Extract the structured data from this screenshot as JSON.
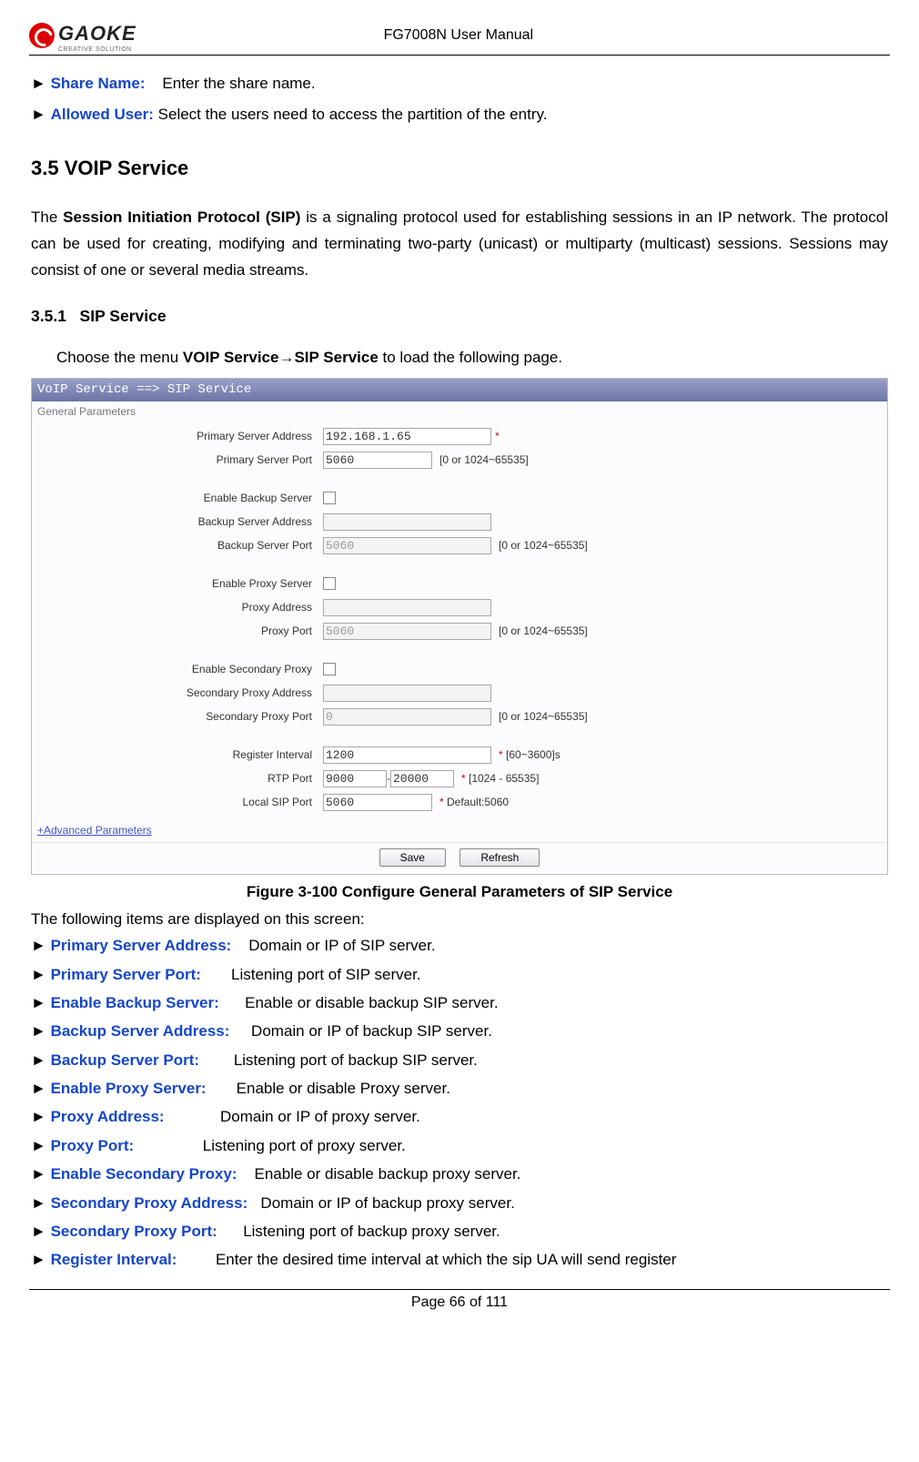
{
  "header": {
    "logo_text": "GAOKE",
    "logo_sub": "CREATIVE SOLUTION",
    "doc_title": "FG7008N User Manual"
  },
  "top_fields": [
    {
      "label": "Share Name:",
      "desc": "Enter the share name."
    },
    {
      "label": "Allowed User:",
      "desc": "Select the users need to access the partition of the entry."
    }
  ],
  "section": {
    "number": "3.5",
    "title": "VOIP Service"
  },
  "sip_intro_parts": {
    "pre": "The ",
    "bold": "Session Initiation Protocol (SIP)",
    "post": " is a signaling protocol used for establishing sessions in an IP network. The protocol can be used for creating, modifying and terminating two-party (unicast) or multiparty (multicast) sessions. Sessions may consist of one or several media streams."
  },
  "subsection": {
    "number": "3.5.1",
    "title": "SIP Service"
  },
  "menu_instruction": {
    "pre": "Choose the menu ",
    "b1": "VOIP Service",
    "arrow": "→",
    "b2": "SIP Service",
    "post": " to load the following page."
  },
  "ui": {
    "breadcrumb": "VoIP Service ==> SIP Service",
    "fieldset": "General Parameters",
    "rows": {
      "primary_addr": {
        "label": "Primary Server Address",
        "value": "192.168.1.65",
        "hint": "*",
        "star": true
      },
      "primary_port": {
        "label": "Primary Server Port",
        "value": "5060",
        "hint": "[0 or 1024~65535]"
      },
      "enable_backup": {
        "label": "Enable Backup Server"
      },
      "backup_addr": {
        "label": "Backup Server Address",
        "value": ""
      },
      "backup_port": {
        "label": "Backup Server Port",
        "value": "5060",
        "hint": "[0 or 1024~65535]"
      },
      "enable_proxy": {
        "label": "Enable Proxy Server"
      },
      "proxy_addr": {
        "label": "Proxy Address",
        "value": ""
      },
      "proxy_port": {
        "label": "Proxy Port",
        "value": "5060",
        "hint": "[0 or 1024~65535]"
      },
      "enable_secproxy": {
        "label": "Enable Secondary Proxy"
      },
      "secproxy_addr": {
        "label": "Secondary Proxy Address",
        "value": ""
      },
      "secproxy_port": {
        "label": "Secondary Proxy Port",
        "value": "0",
        "hint": "[0 or 1024~65535]"
      },
      "reg_interval": {
        "label": "Register Interval",
        "value": "1200",
        "hint": "* [60~3600]s",
        "star": true
      },
      "rtp_port": {
        "label": "RTP Port",
        "from": "9000",
        "to": "20000",
        "sep": " - ",
        "hint": "* [1024 - 65535]",
        "star": true
      },
      "local_sip": {
        "label": "Local SIP Port",
        "value": "5060",
        "hint": "* Default:5060",
        "star": true
      }
    },
    "adv_link": "+Advanced Parameters",
    "save_btn": "Save",
    "refresh_btn": "Refresh"
  },
  "figure_caption": "Figure 3-100 Configure General Parameters of SIP Service",
  "following_items": "The following items are displayed on this screen:",
  "defs": [
    {
      "label": "Primary Server Address:",
      "desc": "Domain or IP of SIP server."
    },
    {
      "label": "Primary Server Port:",
      "desc": "Listening port of SIP server."
    },
    {
      "label": "Enable Backup Server:",
      "desc": "Enable or disable backup SIP server."
    },
    {
      "label": "Backup Server Address:",
      "desc": "Domain or IP of backup SIP server."
    },
    {
      "label": "Backup Server Port:",
      "desc": "Listening port of backup SIP server."
    },
    {
      "label": "Enable Proxy Server:",
      "desc": "Enable or disable Proxy server."
    },
    {
      "label": "Proxy Address:",
      "desc": "Domain or IP of proxy server."
    },
    {
      "label": "Proxy Port:",
      "desc": "Listening port of proxy server."
    },
    {
      "label": "Enable Secondary Proxy:",
      "desc": "Enable or disable backup proxy server."
    },
    {
      "label": "Secondary Proxy Address:",
      "desc": "Domain or IP of backup proxy server."
    },
    {
      "label": "Secondary Proxy Port:",
      "desc": "Listening port of backup proxy server."
    },
    {
      "label": "Register Interval:",
      "desc": "Enter the desired time interval at which the sip UA will send register"
    }
  ],
  "footer": "Page 66 of 111"
}
